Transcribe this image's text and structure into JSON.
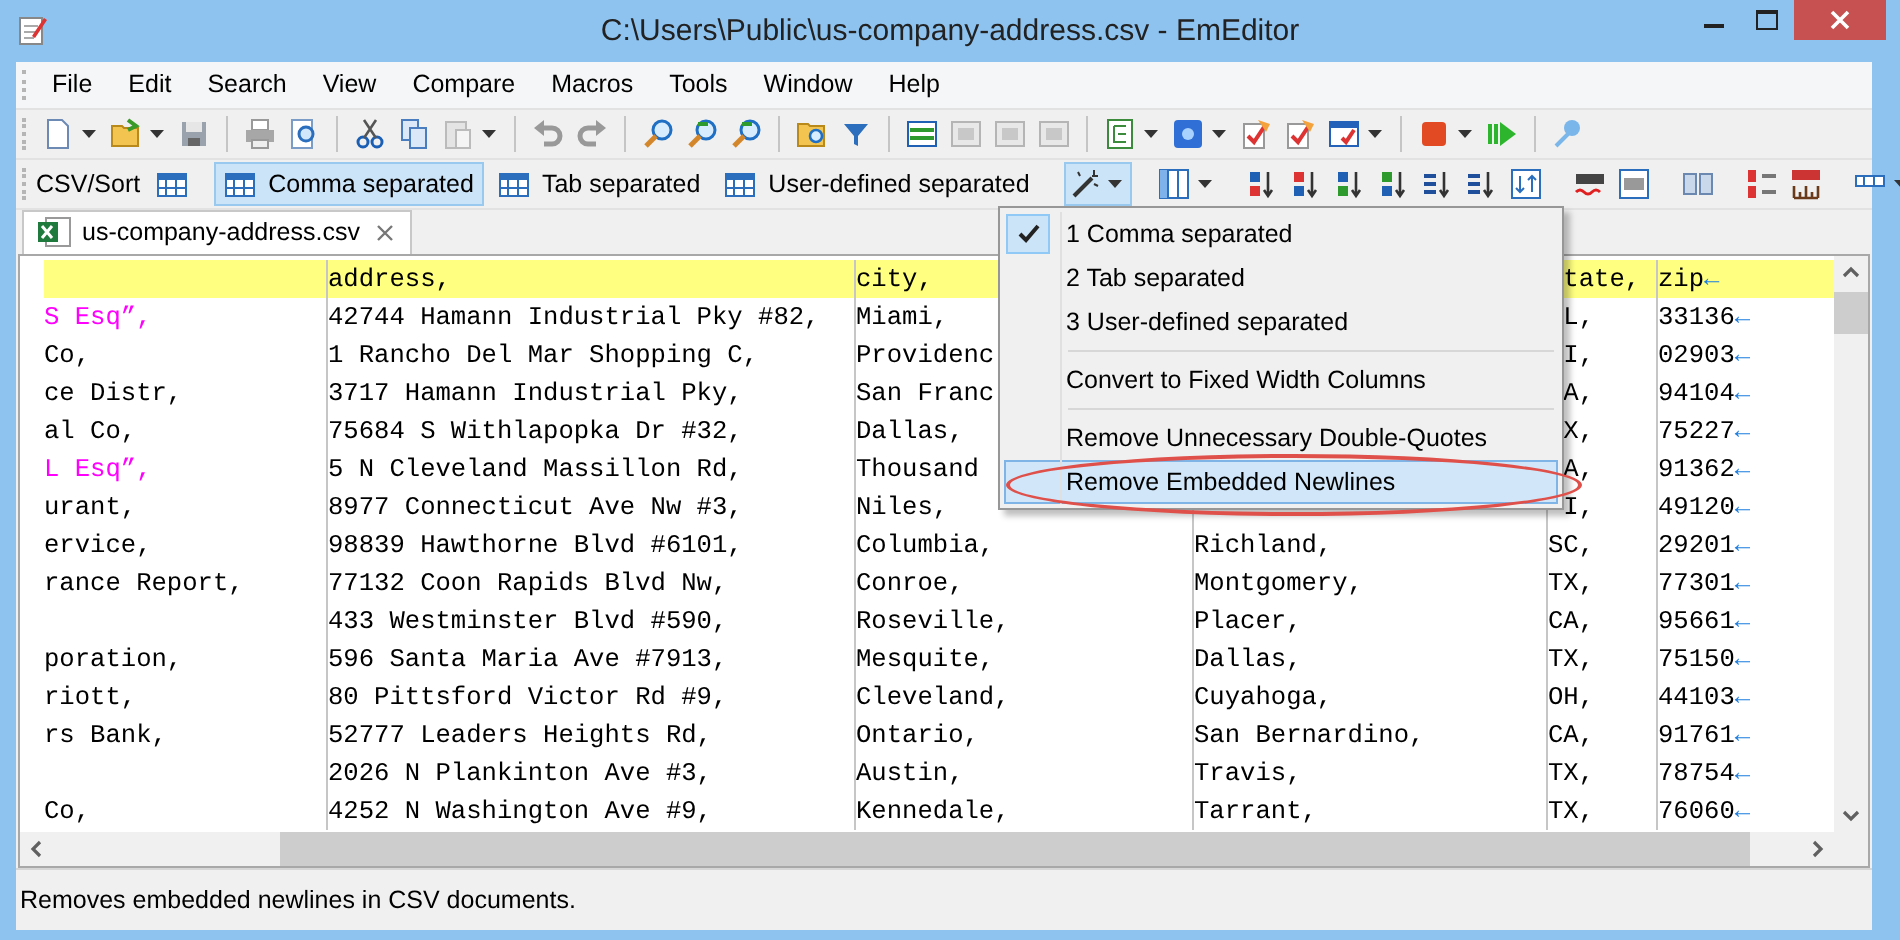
{
  "window": {
    "title": "C:\\Users\\Public\\us-company-address.csv - EmEditor"
  },
  "menu_bar": [
    "File",
    "Edit",
    "Search",
    "View",
    "Compare",
    "Macros",
    "Tools",
    "Window",
    "Help"
  ],
  "csv_toolbar": {
    "label": "CSV/Sort",
    "buttons": [
      {
        "label": "Comma separated",
        "selected": true
      },
      {
        "label": "Tab separated",
        "selected": false
      },
      {
        "label": "User-defined separated",
        "selected": false
      }
    ]
  },
  "tabs": [
    {
      "label": "us-company-address.csv",
      "selected": true
    }
  ],
  "grid": {
    "header": {
      "address": "address,",
      "city": "city,",
      "state": "tate,",
      "zip": "zip",
      "eol": "←"
    },
    "rows": [
      {
        "column_1": {
          "text": "S Esq”,",
          "color": "#ff00ff"
        },
        "address": "42744 Hamann Industrial Pky #82,",
        "city": "Miami,",
        "state": "L,",
        "zip": "33136",
        "eol": "←"
      },
      {
        "column_1": {
          "text": "Co,",
          "color": "#000000"
        },
        "address": "1 Rancho Del Mar Shopping C,",
        "city": "Providenc",
        "state": "I,",
        "zip": "02903",
        "eol": "←"
      },
      {
        "column_1": {
          "text": "ce Distr,",
          "color": "#000000"
        },
        "address": "3717 Hamann Industrial Pky,",
        "city": "San Franc",
        "state": "A,",
        "zip": "94104",
        "eol": "←"
      },
      {
        "column_1": {
          "text": "al Co,",
          "color": "#000000"
        },
        "address": "75684 S Withlapopka Dr #32,",
        "city": "Dallas,",
        "state": "X,",
        "zip": "75227",
        "eol": "←"
      },
      {
        "column_1": {
          "text": "L Esq”,",
          "color": "#ff00ff"
        },
        "address": "5 N Cleveland Massillon Rd,",
        "city": "Thousand",
        "state": "A,",
        "zip": "91362",
        "eol": "←"
      },
      {
        "column_1": {
          "text": "urant,",
          "color": "#000000"
        },
        "address": "8977 Connecticut Ave Nw #3,",
        "city": "Niles,",
        "state": "I,",
        "zip": "49120",
        "eol": "←"
      },
      {
        "column_1": {
          "text": "ervice,",
          "color": "#000000"
        },
        "address": "98839 Hawthorne Blvd #6101,",
        "city": "Columbia,",
        "column_4": "Richland,",
        "state": "SC,",
        "zip": "29201",
        "eol": "←"
      },
      {
        "column_1": {
          "text": "rance Report,",
          "color": "#000000"
        },
        "address": "77132 Coon Rapids Blvd Nw,",
        "city": "Conroe,",
        "column_4": "Montgomery,",
        "state": "TX,",
        "zip": "77301",
        "eol": "←"
      },
      {
        "address": "433 Westminster Blvd #590,",
        "city": "Roseville,",
        "column_4": "Placer,",
        "state": "CA,",
        "zip": "95661",
        "eol": "←"
      },
      {
        "column_1": {
          "text": "poration,",
          "color": "#000000"
        },
        "address": "596 Santa Maria Ave #7913,",
        "city": "Mesquite,",
        "column_4": "Dallas,",
        "state": "TX,",
        "zip": "75150",
        "eol": "←"
      },
      {
        "column_1": {
          "text": "riott,",
          "color": "#000000"
        },
        "address": "80 Pittsford Victor Rd #9,",
        "city": "Cleveland,",
        "column_4": "Cuyahoga,",
        "state": "OH,",
        "zip": "44103",
        "eol": "←"
      },
      {
        "column_1": {
          "text": "rs Bank,",
          "color": "#000000"
        },
        "address": "52777 Leaders Heights Rd,",
        "city": "Ontario,",
        "column_4": "San Bernardino,",
        "state": "CA,",
        "zip": "91761",
        "eol": "←"
      },
      {
        "address": "2026 N Plankinton Ave #3,",
        "city": "Austin,",
        "column_4": "Travis,",
        "state": "TX,",
        "zip": "78754",
        "eol": "←"
      },
      {
        "column_1": {
          "text": "Co,",
          "color": "#000000"
        },
        "address": "4252 N Washington Ave #9,",
        "city": "Kennedale,",
        "column_4": "Tarrant,",
        "state": "TX,",
        "zip": "76060",
        "eol": "←"
      }
    ]
  },
  "dropdown_menu": {
    "groups": [
      [
        {
          "label": "1 Comma separated",
          "checked": true,
          "selected": false
        },
        {
          "label": "2 Tab separated",
          "checked": false,
          "selected": false
        },
        {
          "label": "3 User-defined separated",
          "checked": false,
          "selected": false
        }
      ],
      [
        {
          "label": "Convert to Fixed Width Columns",
          "checked": false,
          "selected": false
        }
      ],
      [
        {
          "label": "Remove Unnecessary Double-Quotes",
          "checked": false,
          "selected": false
        },
        {
          "label": "Remove Embedded Newlines",
          "checked": false,
          "selected": true
        }
      ]
    ]
  },
  "status_bar": "Removes embedded newlines in CSV documents."
}
